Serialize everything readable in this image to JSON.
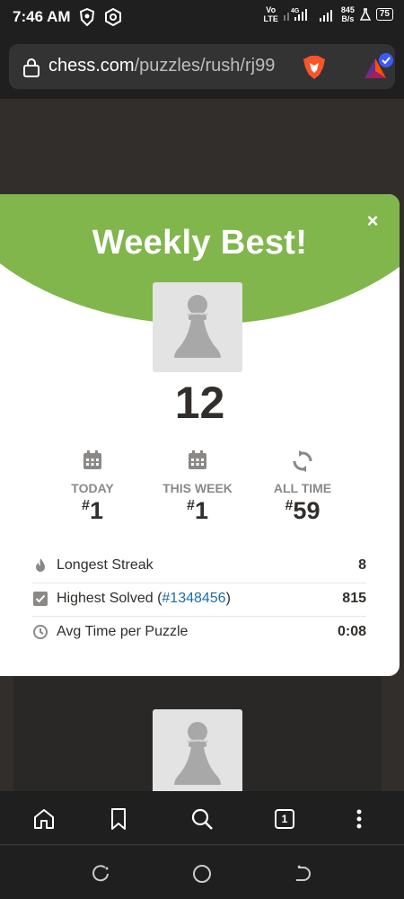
{
  "status_bar": {
    "time": "7:46 AM",
    "network_top": "Vo",
    "network_bottom": "LTE",
    "signal_label": "4G",
    "speed_top": "845",
    "speed_bottom": "B/s",
    "battery": "75"
  },
  "browser": {
    "url_domain": "chess.com",
    "url_path": "/puzzles/rush/rj99",
    "tab_count": "1"
  },
  "modal": {
    "title": "Weekly Best!",
    "close_label": "×",
    "score": "12",
    "stats": [
      {
        "label": "TODAY",
        "prefix": "#",
        "value": "1",
        "icon": "calendar-icon"
      },
      {
        "label": "THIS WEEK",
        "prefix": "#",
        "value": "1",
        "icon": "calendar-icon"
      },
      {
        "label": "ALL TIME",
        "prefix": "#",
        "value": "59",
        "icon": "refresh-icon"
      }
    ],
    "rows": [
      {
        "label": "Longest Streak",
        "value": "8",
        "icon": "flame-icon"
      },
      {
        "label_before": "Highest Solved (",
        "link": "#1348456",
        "label_after": ")",
        "value": "815",
        "icon": "checkbox-icon"
      },
      {
        "label": "Avg Time per Puzzle",
        "value": "0:08",
        "icon": "clock-icon"
      }
    ]
  },
  "colors": {
    "accent_green": "#81b64c",
    "page_bg": "#312e2b",
    "link_blue": "#1a6ea8",
    "label_gray": "#8b8987"
  }
}
